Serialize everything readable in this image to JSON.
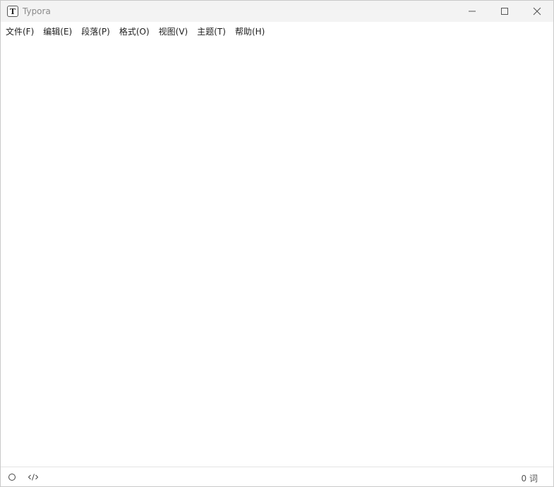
{
  "window": {
    "title": "Typora",
    "app_icon_letter": "T"
  },
  "controls": {
    "minimize_icon": "minimize-icon",
    "maximize_icon": "maximize-icon",
    "close_icon": "close-icon"
  },
  "menu": {
    "items": [
      {
        "label": "文件(F)"
      },
      {
        "label": "编辑(E)"
      },
      {
        "label": "段落(P)"
      },
      {
        "label": "格式(O)"
      },
      {
        "label": "视图(V)"
      },
      {
        "label": "主题(T)"
      },
      {
        "label": "帮助(H)"
      }
    ]
  },
  "statusbar": {
    "sidebar_toggle_icon": "circle-icon",
    "source_code_icon": "code-icon",
    "word_count": "0 词"
  }
}
